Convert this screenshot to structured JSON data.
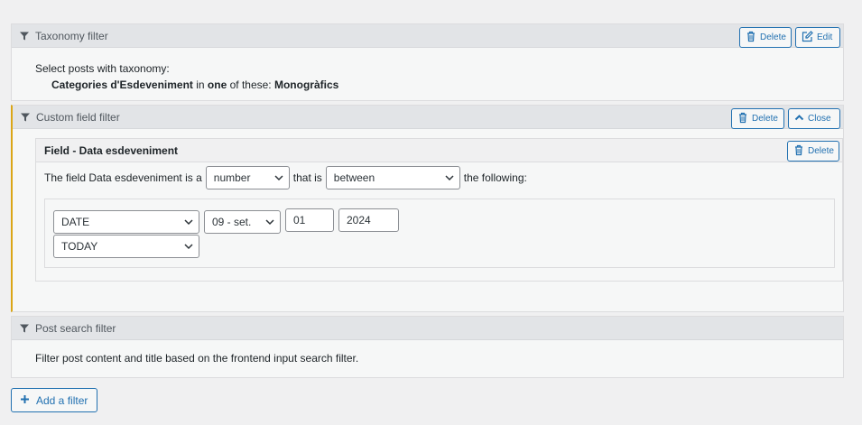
{
  "taxonomy_filter": {
    "title": "Taxonomy filter",
    "delete_label": "Delete",
    "edit_label": "Edit",
    "intro": "Select posts with taxonomy:",
    "taxonomy_name": "Categories d'Esdeveniment",
    "word_in": " in ",
    "match_mode": "one",
    "word_of_these": " of these: ",
    "terms": "Monogràfics"
  },
  "custom_field_filter": {
    "title": "Custom field filter",
    "delete_label": "Delete",
    "close_label": "Close",
    "field": {
      "title": "Field - Data esdeveniment",
      "delete_label": "Delete",
      "prefix": "The field Data esdeveniment is a",
      "type_value": "number",
      "that_is": "that is",
      "compare_value": "between",
      "suffix": "the following:",
      "from": {
        "source_value": "DATE",
        "month_value": "09 - set.",
        "day_value": "01",
        "year_value": "2024"
      },
      "to": {
        "source_value": "TODAY"
      }
    }
  },
  "post_search_filter": {
    "title": "Post search filter",
    "description": "Filter post content and title based on the frontend input search filter."
  },
  "add_filter_label": "Add a filter",
  "colors": {
    "accent": "#2271b1",
    "active_border": "#dba617"
  }
}
